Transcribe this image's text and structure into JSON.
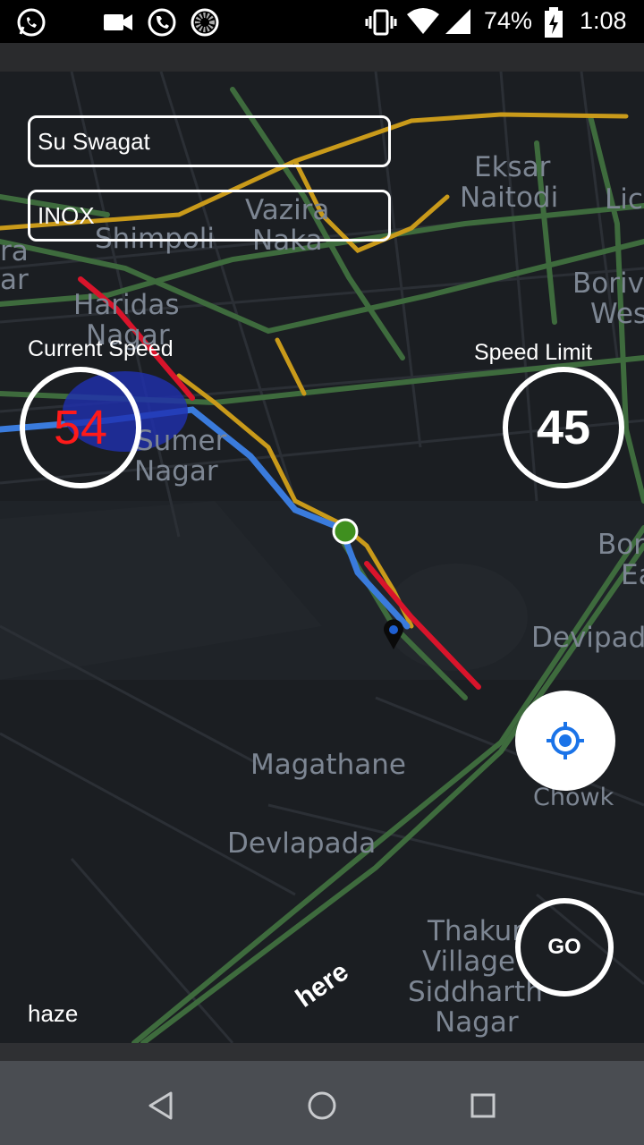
{
  "status_bar": {
    "battery": "74%",
    "time": "1:08",
    "icons": [
      "whatsapp-icon",
      "video-camera-icon",
      "call-icon",
      "loading-icon",
      "vibrate-icon",
      "wifi-icon",
      "signal-icon",
      "battery-charging-icon"
    ]
  },
  "route": {
    "origin": "Su Swagat",
    "destination": "INOX"
  },
  "speed": {
    "current_label": "Current Speed",
    "current_value": "54",
    "limit_label": "Speed Limit",
    "limit_value": "45"
  },
  "controls": {
    "go_label": "GO",
    "locate_icon": "my-location-icon"
  },
  "weather": "haze",
  "map": {
    "brand": "here",
    "labels": [
      "Eksar",
      "Naitodi",
      "Lic",
      "Shimpoli",
      "Vazira",
      "Naka",
      "Haridas",
      "Nagar",
      "Boriv",
      "Wes",
      "Sumer",
      "Nagar",
      "Bor",
      "Ea",
      "Devipad",
      "Magathane",
      "Chowk",
      "Devlapada",
      "Thakur",
      "Village",
      "Siddharth",
      "Nagar",
      "ra",
      "ar"
    ]
  },
  "nav_bar": {
    "icons": [
      "back-icon",
      "home-icon",
      "recents-icon"
    ]
  },
  "colors": {
    "current_speed": "#ff1a1a",
    "route_blue": "#3a7bdc",
    "traffic_red": "#d9142b",
    "road_green": "#3e6b3d",
    "road_yellow": "#c99a1a"
  }
}
